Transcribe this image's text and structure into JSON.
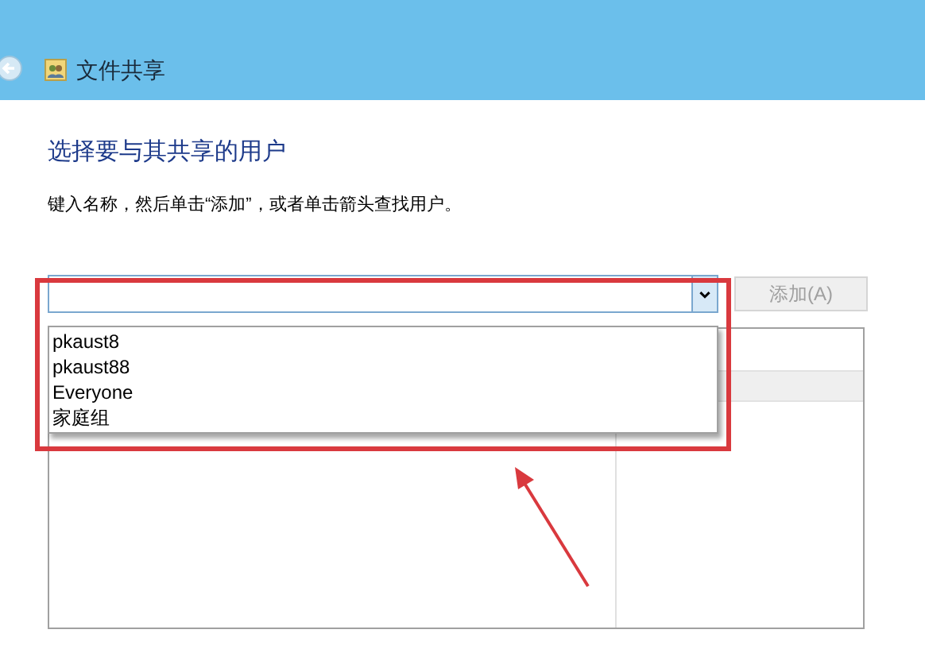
{
  "window": {
    "title": "文件共享"
  },
  "heading": "选择要与其共享的用户",
  "instruction": "键入名称，然后单击“添加”，或者单击箭头查找用户。",
  "user_combo": {
    "expanded": true,
    "options": [
      {
        "label": "pkaust8"
      },
      {
        "label": "pkaust88"
      },
      {
        "label": "Everyone"
      },
      {
        "label": "家庭组"
      }
    ]
  },
  "add_button": {
    "label": "添加(A)",
    "disabled": true
  }
}
